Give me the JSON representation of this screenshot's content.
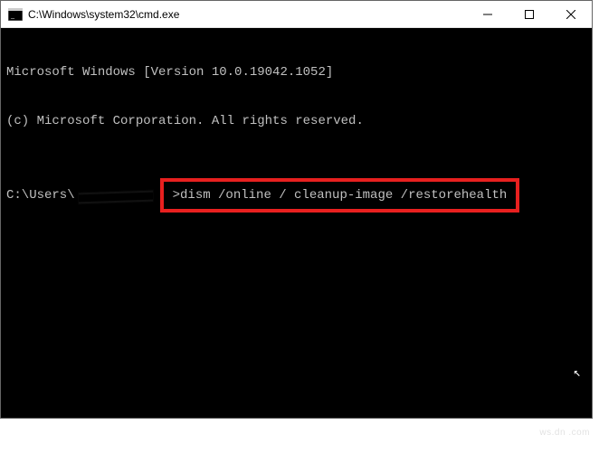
{
  "window": {
    "title": "C:\\Windows\\system32\\cmd.exe"
  },
  "terminal": {
    "line1": "Microsoft Windows [Version 10.0.19042.1052]",
    "line2": "(c) Microsoft Corporation. All rights reserved.",
    "prompt_prefix": "C:\\Users\\",
    "command": ">dism /online / cleanup-image /restorehealth"
  },
  "colors": {
    "highlight": "#e8201f",
    "terminal_bg": "#000000",
    "terminal_fg": "#c0c0c0"
  }
}
